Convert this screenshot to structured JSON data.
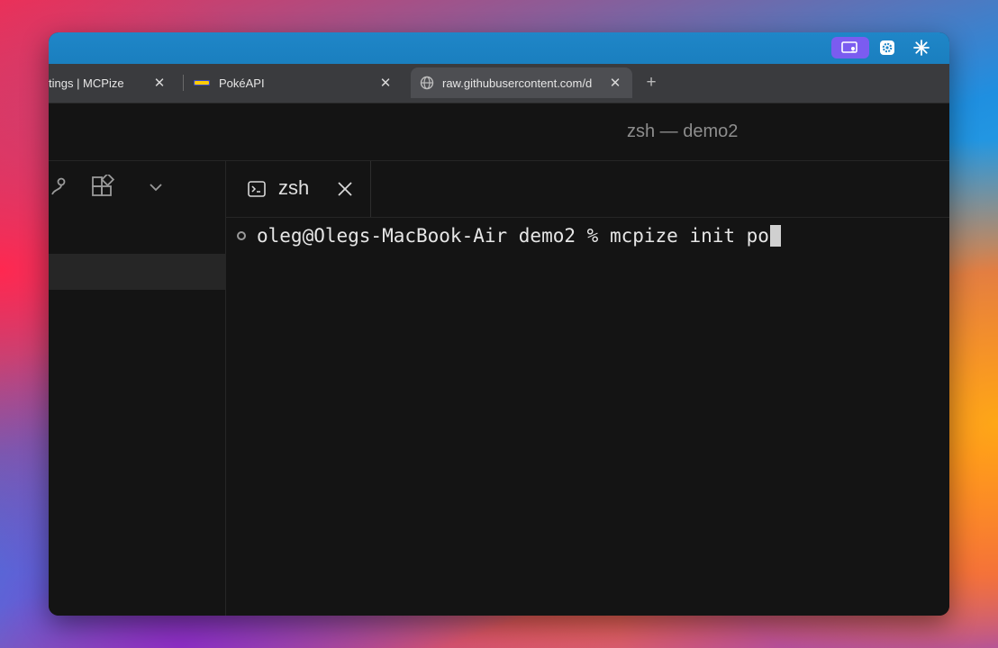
{
  "menubar": {
    "icons": [
      "screen-share-icon",
      "gear-app-icon",
      "sparkle-icon"
    ],
    "accent": "#7b5cf0"
  },
  "browser": {
    "tabs": [
      {
        "label": "tings | MCPize",
        "active": false
      },
      {
        "label": "PokéAPI",
        "active": false,
        "favicon": "pokeapi-logo-icon"
      },
      {
        "label": "raw.githubusercontent.com/d",
        "active": true,
        "favicon": "globe-icon"
      }
    ],
    "new_tab_label": "+",
    "close_label": "✕"
  },
  "window": {
    "title": "zsh — demo2"
  },
  "sidebar": {
    "icons": [
      "source-control-icon",
      "extensions-icon",
      "chevron-down-icon"
    ]
  },
  "editor": {
    "tab_label": "zsh",
    "tab_icon": "terminal-icon"
  },
  "terminal": {
    "prompt": "oleg@Olegs-MacBook-Air demo2 % ",
    "command": "mcpize init po"
  },
  "colors": {
    "background": "#141414",
    "text": "#e6e6e6",
    "title": "#8d8d8d",
    "menubar": "#1f86c8"
  }
}
